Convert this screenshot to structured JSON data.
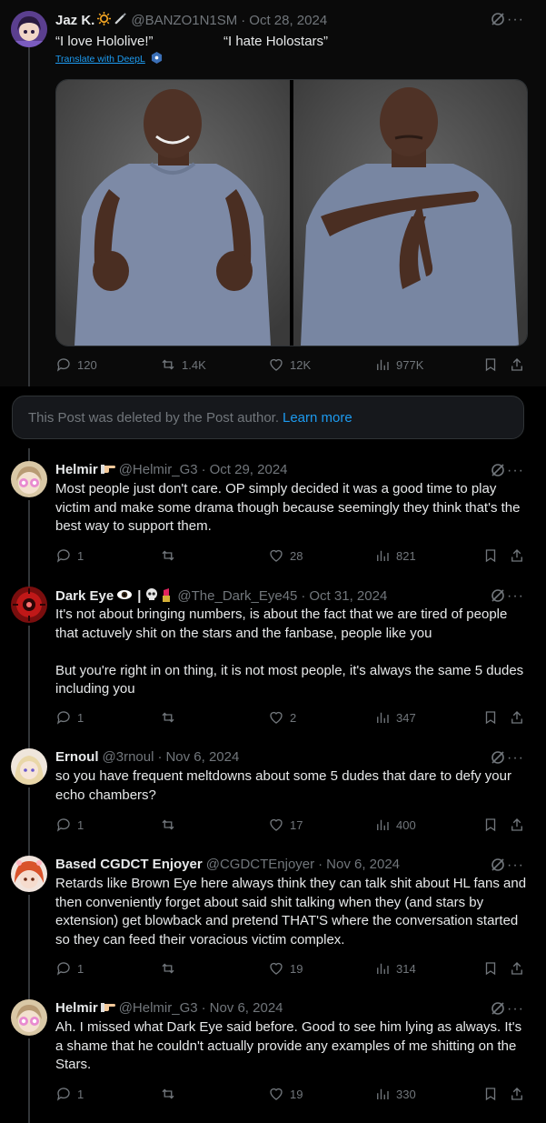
{
  "main_post": {
    "name": "Jaz K.",
    "handle": "@BANZO1N1SM",
    "date": "Oct 28, 2024",
    "left_quote": "“I love Hololive!”",
    "right_quote": "“I hate Holostars”",
    "translate": "Translate with DeepL",
    "replies": "120",
    "reposts": "1.4K",
    "likes": "12K",
    "views": "977K"
  },
  "deleted_notice": {
    "text": "This Post was deleted by the Post author.",
    "link": "Learn more"
  },
  "replies": [
    {
      "name": "Helmir",
      "handle": "@Helmir_G3",
      "date": "Oct 29, 2024",
      "text": "Most people just don't care. OP simply decided it was a good time to play victim and make some drama though because seemingly they think that's the best way to support them.",
      "replies": "1",
      "reposts": "",
      "likes": "28",
      "views": "821"
    },
    {
      "name": "Dark Eye",
      "name_suffix": "|",
      "handle": "@The_Dark_Eye45",
      "date": "Oct 31, 2024",
      "text": "It's not about bringing numbers, is about the fact that we are tired of people that actuvely shit on the stars and the fanbase, people like you\n\nBut you're right in on thing, it is not most people, it's always the same 5 dudes including you",
      "replies": "1",
      "reposts": "",
      "likes": "2",
      "views": "347"
    },
    {
      "name": "Ernoul",
      "handle": "@3rnoul",
      "date": "Nov 6, 2024",
      "text": "so you have frequent meltdowns about some 5 dudes that dare to defy your echo chambers?",
      "replies": "1",
      "reposts": "",
      "likes": "17",
      "views": "400"
    },
    {
      "name": "Based CGDCT Enjoyer",
      "handle": "@CGDCTEnjoyer",
      "date": "Nov 6, 2024",
      "text": "Retards like Brown Eye here always think they can talk shit about HL fans and then conveniently forget about said shit talking when they (and stars by extension) get blowback and pretend THAT'S where the conversation started so they can feed their voracious victim complex.",
      "replies": "1",
      "reposts": "",
      "likes": "19",
      "views": "314"
    },
    {
      "name": "Helmir",
      "handle": "@Helmir_G3",
      "date": "Nov 6, 2024",
      "text": "Ah. I missed what Dark Eye said before. Good to see him lying as always. It's a shame that he couldn't actually provide any examples of me shitting on the Stars.",
      "replies": "1",
      "reposts": "",
      "likes": "19",
      "views": "330"
    }
  ],
  "colors": {
    "background": "#000000",
    "text": "#e7e9ea",
    "muted": "#71767b",
    "link": "#1d9bf0",
    "border": "#2f3336"
  }
}
